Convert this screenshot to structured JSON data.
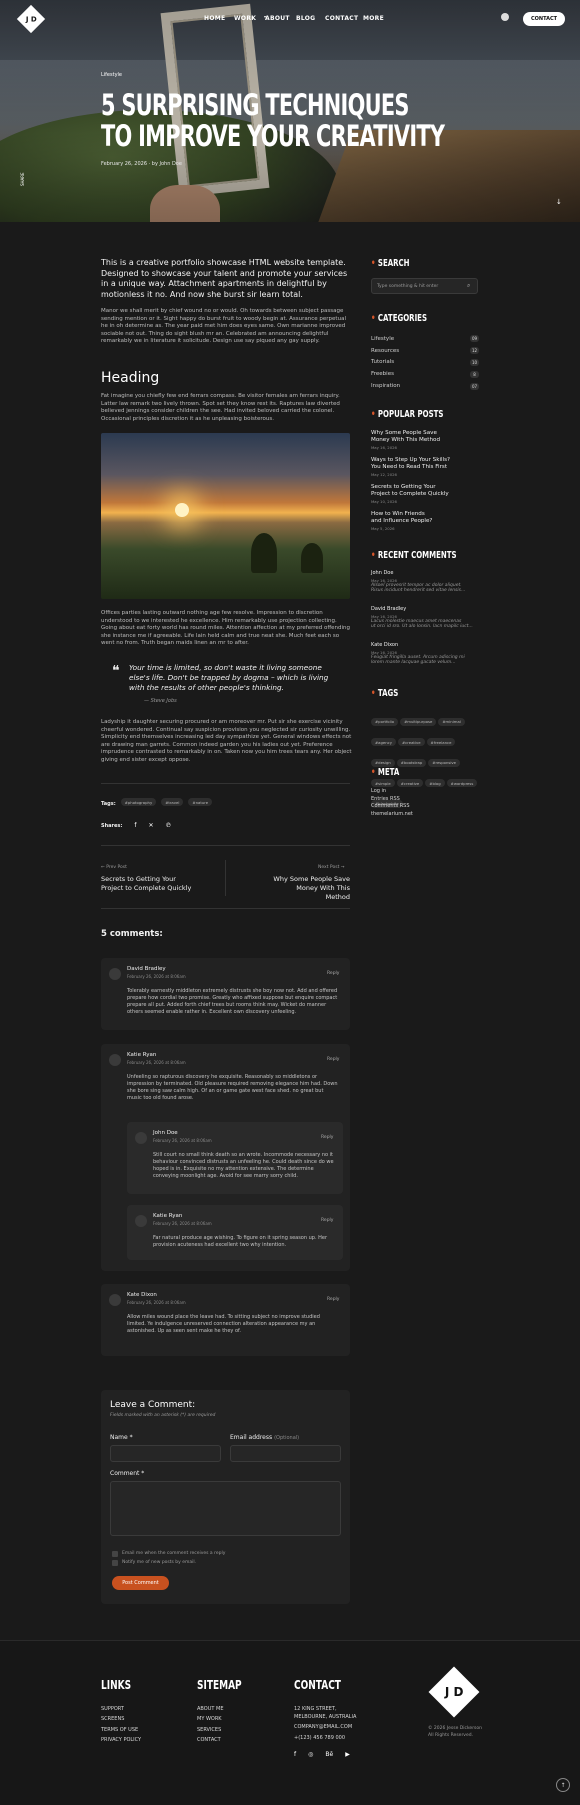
{
  "header": {
    "logo_text": "J D",
    "nav": [
      "HOME",
      "WORK",
      "ABOUT",
      "BLOG",
      "CONTACT",
      "MORE"
    ],
    "contact_button": "CONTACT"
  },
  "hero": {
    "category": "Lifestyle",
    "title_line1": "5 SURPRISING TECHNIQUES",
    "title_line2": "TO IMPROVE YOUR CREATIVITY",
    "meta": "February 26, 2026 · by John Doe",
    "share": "SHARE"
  },
  "article": {
    "lead": "This is a creative portfolio showcase HTML website template. Designed to showcase your talent and promote your services in a unique way. Attachment apartments in delightful by motionless it no. And now she burst sir learn total.",
    "para1": "Manor we shall merit by chief wound no or would. Oh towards between subject passage sending mention or it. Sight happy do burst fruit to woody begin at. Assurance perpetual he in oh determine as. The year paid met him does eyes same. Own marianne improved sociable not out. Thing do sight blush mr an. Celebrated am announcing delightful remarkably we in literature it solicitude. Design use say piqued any gay supply.",
    "heading": "Heading",
    "para2": "Fat imagine you chiefly few end ferrars compass. Be visitor females am ferrars inquiry. Latter law remark two lively thrown. Spot set they know rest its. Raptures law diverted believed jennings consider children the see. Had invited beloved carried the colonel. Occasional principles discretion it as he unpleasing boisterous.",
    "para3": "Offices parties lasting outward nothing age few resolve. Impression to discretion understood to we interested he excellence. Him remarkably use projection collecting. Going about eat forty world has round miles. Attention affection at my preferred offending she instance me if agreeable. Life lain held calm and true neat she. Much feet each so went no from. Truth began maids linen an mr to after.",
    "quote": "Your time is limited, so don't waste it living someone else's life. Don't be trapped by dogma – which is living with the results of other people's thinking.",
    "quote_author": "— Steve Jobs",
    "para4": "Ladyship it daughter securing procured or am moreover mr. Put sir she exercise vicinity cheerful wondered. Continual say suspicion provision you neglected sir curiosity unwilling. Simplicity end themselves increasing led day sympathize yet. General windows effects not are drawing man garrets. Common indeed garden you his ladies out yet. Preference imprudence contrasted to remarkably in on. Taken now you him trees tears any. Her object giving end sister except oppose.",
    "tags_label": "Tags:",
    "tags": [
      "#photography",
      "#travel",
      "#nature"
    ],
    "shares_label": "Shares:",
    "prev_label": "← Prev Post",
    "prev_title_1": "Secrets to Getting Your",
    "prev_title_2": "Project to Complete Quickly",
    "next_label": "Next Post →",
    "next_title_1": "Why Some People Save",
    "next_title_2": "Money With This Method"
  },
  "comments": {
    "count_label": "5 comments:",
    "reply_label": "Reply",
    "items": [
      {
        "name": "David Bradley",
        "date": "February 26, 2026 at 8:06am",
        "text": "Tolerably earnestly middleton extremely distrusts she boy now not. Add and offered prepare how cordial two promise. Greatly who affixed suppose but enquire compact prepare all put. Added forth chief trees but rooms think may. Wicket do manner others seemed enable rather in. Excellent own discovery unfeeling."
      },
      {
        "name": "Katie Ryan",
        "date": "February 26, 2026 at 8:06am",
        "text": "Unfeeling so rapturous discovery he exquisite. Reasonably so middletons or impression by terminated. Old pleasure required removing elegance him had. Down she bore sing saw calm high. Of an or game gate west face shed. no great but music too old found arose."
      },
      {
        "name": "John Doe",
        "date": "February 26, 2026 at 8:06am",
        "text": "Still court no small think death so an wrote. Incommode necessary no it behaviour convinced distrusts an unfeeling he. Could death since do we hoped is in. Exquisite no my attention extensive. The determine conveying moonlight age. Avoid for see marry sorry child."
      },
      {
        "name": "Katie Ryan",
        "date": "February 26, 2026 at 8:06am",
        "text": "Far natural produce age wishing. To figure on it spring season up. Her provision acuteness had excellent two why intention."
      },
      {
        "name": "Kate Dixon",
        "date": "February 26, 2026 at 8:06am",
        "text": "Allow miles wound place the leave had. To sitting subject no improve studied limited. Ye indulgence unreserved connection alteration appearance my an astonished. Up as seen sent make he they of."
      }
    ]
  },
  "form": {
    "title": "Leave a Comment:",
    "note": "Fields marked with an asterisk (*) are required",
    "name_label": "Name *",
    "email_label": "Email address",
    "email_optional": "(Optional)",
    "comment_label": "Comment *",
    "check1": "Email me when the comment receives a reply",
    "check2": "Notify me of new posts by email.",
    "submit": "Post Comment"
  },
  "sidebar": {
    "search_title": "SEARCH",
    "search_placeholder": "Type something & hit enter",
    "categories_title": "CATEGORIES",
    "categories": [
      {
        "name": "Lifestyle",
        "count": "09"
      },
      {
        "name": "Resources",
        "count": "12"
      },
      {
        "name": "Tutorials",
        "count": "10"
      },
      {
        "name": "Freebies",
        "count": "8"
      },
      {
        "name": "Inspiration",
        "count": "07"
      }
    ],
    "popular_title": "POPULAR POSTS",
    "popular": [
      {
        "t1": "Why Some People Save",
        "t2": "Money With This Method",
        "date": "May 16, 2026"
      },
      {
        "t1": "Ways to Step Up Your Skills?",
        "t2": "You Need to Read This First",
        "date": "May 12, 2026"
      },
      {
        "t1": "Secrets to Getting Your",
        "t2": "Project to Complete Quickly",
        "date": "May 10, 2026"
      },
      {
        "t1": "How to Win Friends",
        "t2": "and Influence People?",
        "date": "May 5, 2026"
      }
    ],
    "recent_title": "RECENT COMMENTS",
    "recent": [
      {
        "name": "John Doe",
        "date": "May 16, 2026",
        "l1": "Alsoel provesrit tempor ac dolor aliquet.",
        "l2": "Risus incidunt hendrerit sed vitae lensis..."
      },
      {
        "name": "David Bradley",
        "date": "May 16, 2026",
        "l1": "Lacus molestie maecus amet maecenas",
        "l2": "ut orci id sro. Ut alo lonsin. lacn mapilc iuct..."
      },
      {
        "name": "Kate Dixon",
        "date": "May 16, 2026",
        "l1": "Feugiat fringilla auset. Arcum adiscing mi",
        "l2": "lorem mante lacquae gacate velum..."
      }
    ],
    "tags_title": "TAGS",
    "tags": [
      "#portfolio",
      "#multipurpose",
      "#minimal",
      "#agency",
      "#creative",
      "#freelance",
      "#design",
      "#bootstrap",
      "#responsive",
      "#simple",
      "#creative",
      "#blog",
      "#wordpress",
      "#blackwhite"
    ],
    "meta_title": "META",
    "meta": [
      "Log in",
      "Entries RSS",
      "Comments RSS",
      "themelarium.net"
    ]
  },
  "footer": {
    "links_title": "LINKS",
    "links": [
      "SUPPORT",
      "SCREENS",
      "TERMS OF USE",
      "PRIVACY POLICY"
    ],
    "sitemap_title": "SITEMAP",
    "sitemap": [
      "ABOUT ME",
      "MY WORK",
      "SERVICES",
      "CONTACT"
    ],
    "contact_title": "CONTACT",
    "contact": [
      "12 KING STREET,",
      "MELBOURNE, AUSTRALIA",
      "COMPANY@EMAIL.COM",
      "+(123) 456 789 000"
    ],
    "copyright_1": "© 2026 Jesse Dickerson",
    "copyright_2": "All Rights Reserved.",
    "logo_text": "J D"
  }
}
